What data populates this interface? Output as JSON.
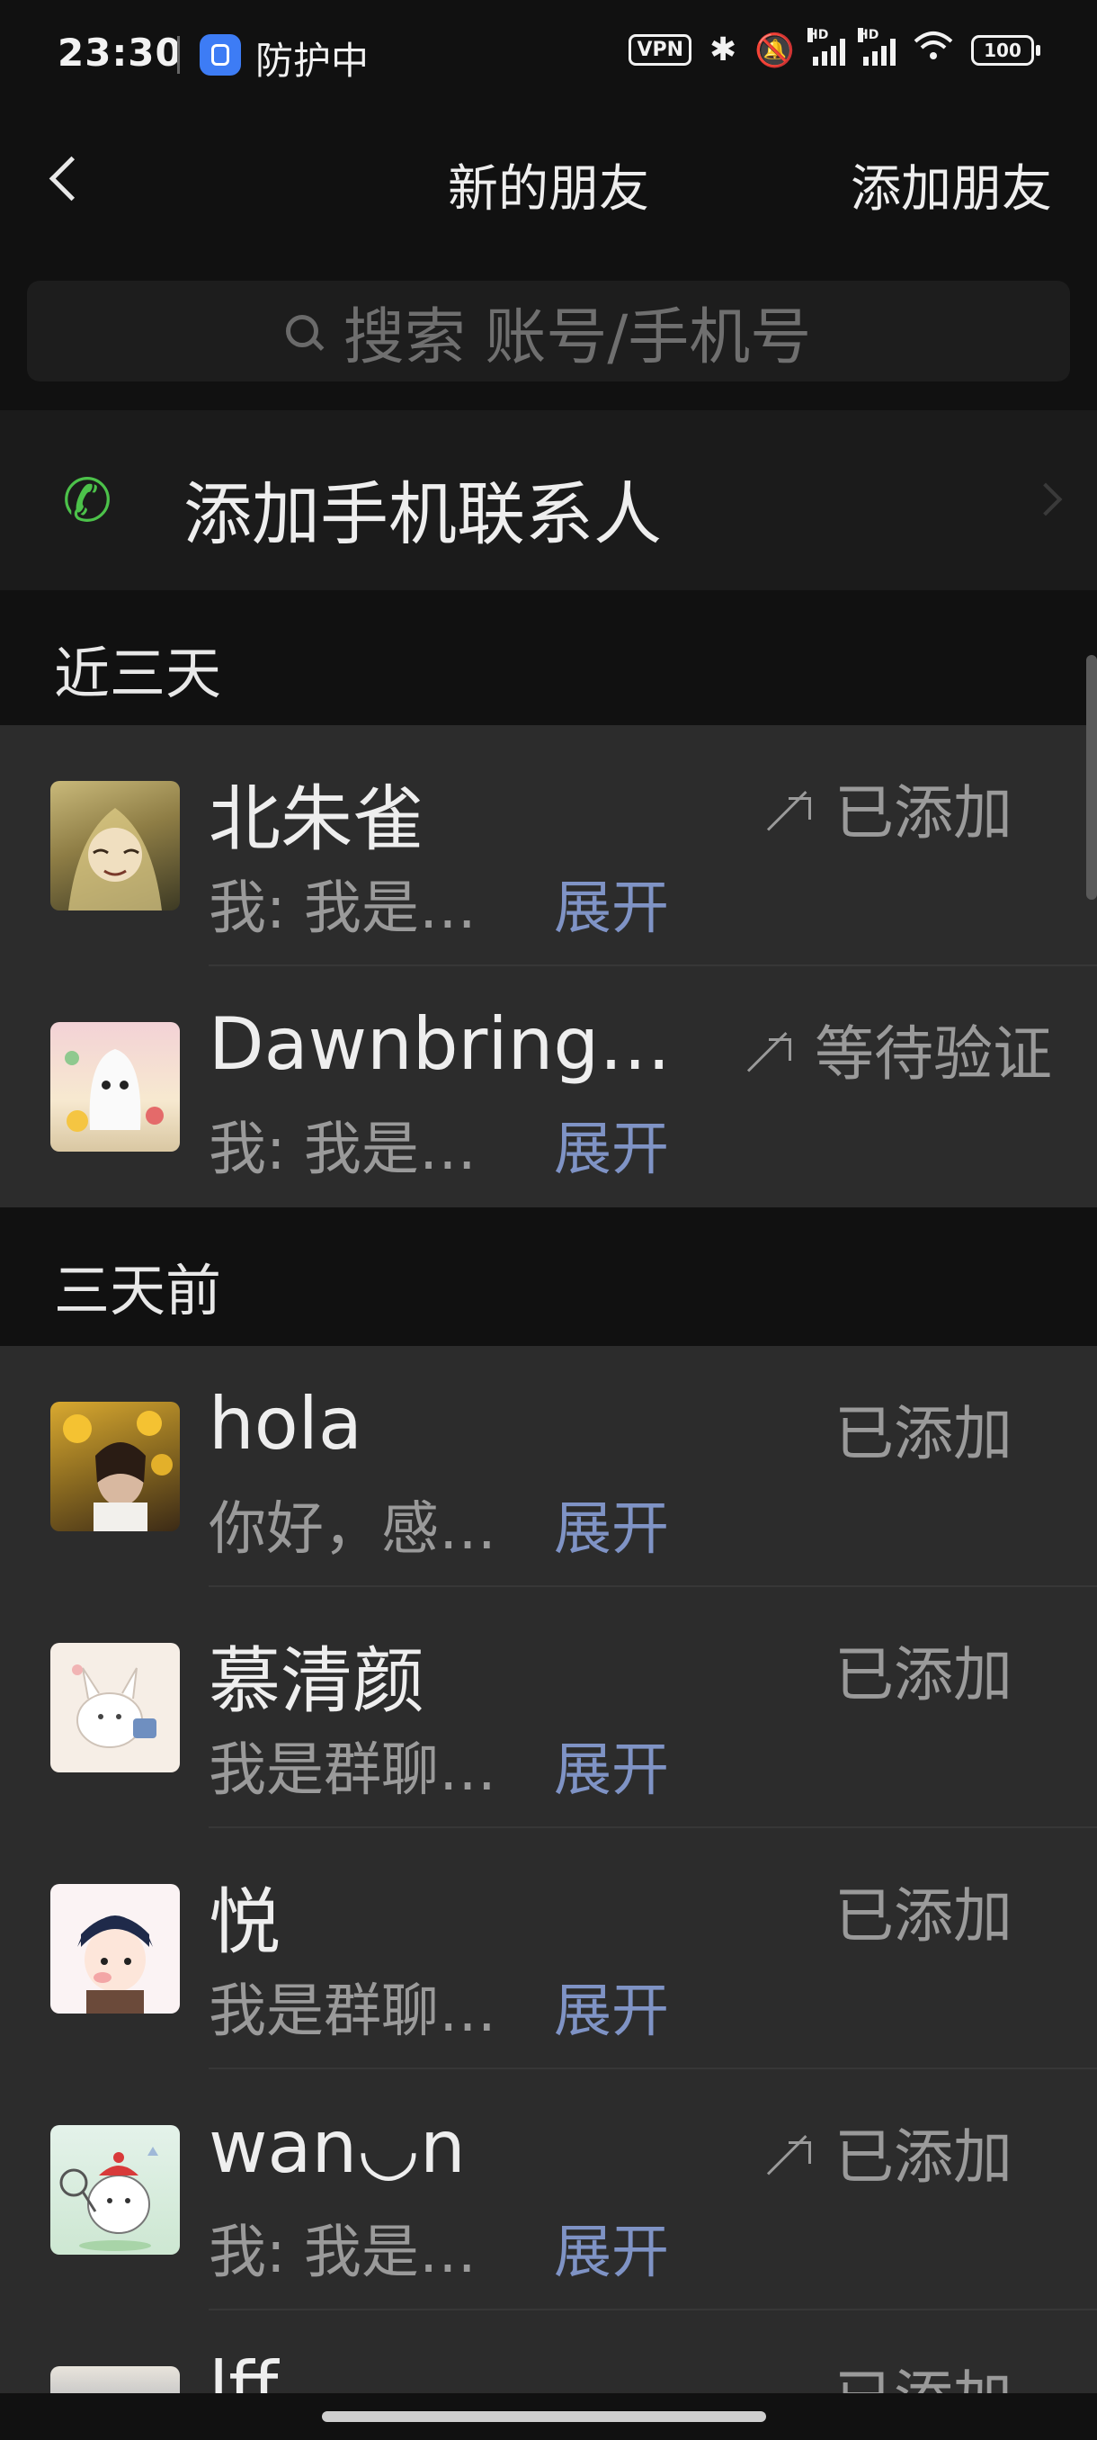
{
  "status_bar": {
    "time": "23:30",
    "protect_text": "防护中",
    "vpn": "VPN",
    "hd1": "HD",
    "hd2": "HD",
    "battery": "100"
  },
  "header": {
    "title": "新的朋友",
    "add_friend": "添加朋友"
  },
  "search": {
    "placeholder": "搜索 账号/手机号"
  },
  "contacts_entry": {
    "label": "添加手机联系人"
  },
  "sections": [
    {
      "title": "近三天"
    },
    {
      "title": "三天前"
    }
  ],
  "recent": [
    {
      "name": "北朱雀",
      "msg": "我: 我是…",
      "expand": "展开",
      "status": "已添加",
      "outgoing": true
    },
    {
      "name": "Dawnbring…",
      "msg": "我: 我是…",
      "expand": "展开",
      "status": "等待验证",
      "outgoing": true
    }
  ],
  "earlier": [
    {
      "name": "hola",
      "msg": "你好，感…",
      "expand": "展开",
      "status": "已添加",
      "outgoing": false
    },
    {
      "name": "慕清颜",
      "msg": "我是群聊…",
      "expand": "展开",
      "status": "已添加",
      "outgoing": false
    },
    {
      "name": "悦",
      "msg": "我是群聊…",
      "expand": "展开",
      "status": "已添加",
      "outgoing": false
    },
    {
      "name": "wan◡n",
      "msg": "我: 我是…",
      "expand": "展开",
      "status": "已添加",
      "outgoing": true
    },
    {
      "name": "lff",
      "msg": "",
      "expand": "",
      "status": "已添加",
      "outgoing": false
    }
  ],
  "colors": {
    "background": "#111111",
    "list_background": "#2c2c2c",
    "accent_link": "#7f93c5",
    "phone_green": "#4cc24a"
  }
}
